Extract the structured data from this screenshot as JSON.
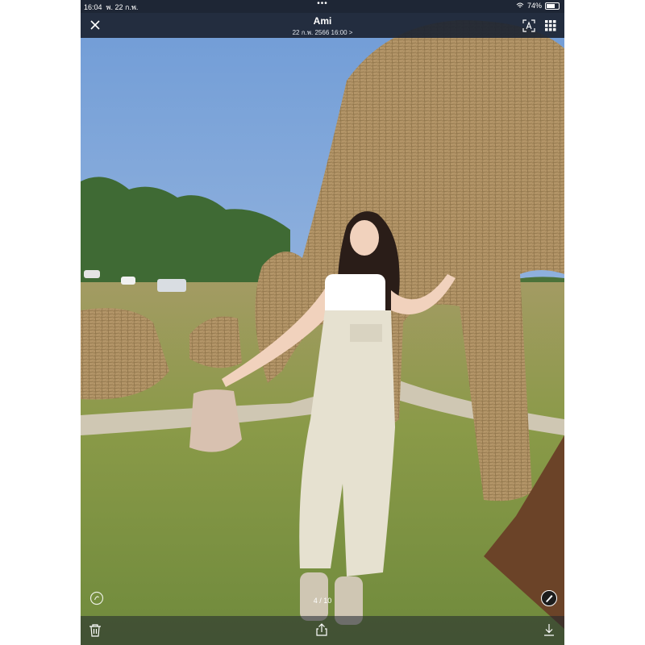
{
  "status": {
    "time": "16:04",
    "date": "พ. 22 ก.พ.",
    "center_dots": "•••",
    "battery": "74%",
    "battery_level": 0.74
  },
  "header": {
    "title": "Ami",
    "subtitle": "22 ก.พ. 2566 16:00 >"
  },
  "viewer": {
    "counter": "4 / 10"
  },
  "icons": {
    "close": "close-icon",
    "text_recognition": "text-recognition-icon",
    "grid": "grid-icon",
    "trash": "trash-icon",
    "share": "share-icon",
    "download": "download-icon",
    "edit": "edit-icon",
    "info": "info-icon"
  },
  "colors": {
    "bar": "#1e2635",
    "sky": "#7ba4d8",
    "grass": "#8c9a4a",
    "straw": "#b79a6a",
    "overalls": "#e6e1d0"
  }
}
